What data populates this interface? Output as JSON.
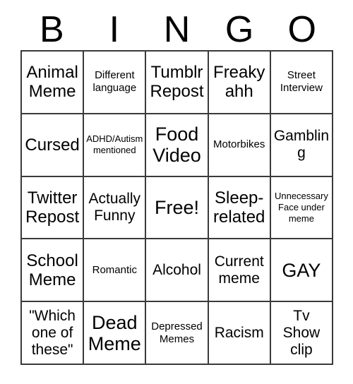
{
  "card": {
    "title": "BINGO",
    "header_letters": [
      "B",
      "I",
      "N",
      "G",
      "O"
    ],
    "colors": {
      "background": "#ffffff",
      "text": "#000000",
      "grid_line": "#3a3a3a"
    },
    "grid_size": "5x5",
    "free_space": "Free!",
    "rows": [
      [
        {
          "label": "Animal\nMeme",
          "size": "lg"
        },
        {
          "label": "Different\nlanguage",
          "size": "sm"
        },
        {
          "label": "Tumblr\nRepost",
          "size": "lg"
        },
        {
          "label": "Freaky\nahh",
          "size": "lg"
        },
        {
          "label": "Street\nInterview",
          "size": "sm"
        }
      ],
      [
        {
          "label": "Cursed",
          "size": "lg"
        },
        {
          "label": "ADHD/Autism\nmentioned",
          "size": "xs"
        },
        {
          "label": "Food\nVideo",
          "size": "xl"
        },
        {
          "label": "Motorbikes",
          "size": "sm"
        },
        {
          "label": "Gambling",
          "size": "md"
        }
      ],
      [
        {
          "label": "Twitter\nRepost",
          "size": "lg"
        },
        {
          "label": "Actually\nFunny",
          "size": "md"
        },
        {
          "label": "Free!",
          "size": "xl"
        },
        {
          "label": "Sleep-\nrelated",
          "size": "lg"
        },
        {
          "label": "Unnecessary\nFace under\nmeme",
          "size": "xs"
        }
      ],
      [
        {
          "label": "School\nMeme",
          "size": "lg"
        },
        {
          "label": "Romantic",
          "size": "sm"
        },
        {
          "label": "Alcohol",
          "size": "md"
        },
        {
          "label": "Current\nmeme",
          "size": "md"
        },
        {
          "label": "GAY",
          "size": "xl"
        }
      ],
      [
        {
          "label": "\"Which\none of\nthese\"",
          "size": "md"
        },
        {
          "label": "Dead\nMeme",
          "size": "xl"
        },
        {
          "label": "Depressed\nMemes",
          "size": "sm"
        },
        {
          "label": "Racism",
          "size": "md"
        },
        {
          "label": "Tv\nShow\nclip",
          "size": "md"
        }
      ]
    ]
  }
}
